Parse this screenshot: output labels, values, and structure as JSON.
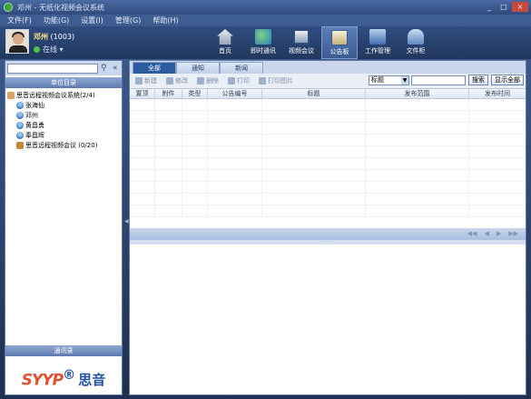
{
  "window": {
    "title": "邓州 - 无纸化视频会议系统",
    "controls": [
      "_",
      "□",
      "×"
    ]
  },
  "menu": [
    "文件(F)",
    "功能(G)",
    "设置(I)",
    "管理(G)",
    "帮助(H)"
  ],
  "user": {
    "name": "邓州",
    "id": "(1003)",
    "status": "在线"
  },
  "nav": [
    {
      "label": "首页",
      "icon": "home-icon"
    },
    {
      "label": "即时通讯",
      "icon": "chat-icon"
    },
    {
      "label": "视频会议",
      "icon": "video-icon"
    },
    {
      "label": "公告板",
      "icon": "board-icon",
      "active": true
    },
    {
      "label": "工作管理",
      "icon": "work-icon"
    },
    {
      "label": "文件柜",
      "icon": "file-icon"
    }
  ],
  "left": {
    "search_placeholder": "",
    "directory_title": "单位目录",
    "tree": [
      {
        "label": "思音远程视频会议系统(2/4)",
        "type": "group",
        "level": 0
      },
      {
        "label": "张海仙",
        "type": "person",
        "level": 1
      },
      {
        "label": "邓州",
        "type": "person",
        "level": 1
      },
      {
        "label": "黄昌勇",
        "type": "person",
        "level": 1
      },
      {
        "label": "奉昌辉",
        "type": "person",
        "level": 1
      },
      {
        "label": "思音远程视频会议 (0/20)",
        "type": "meet",
        "level": 1
      }
    ],
    "contacts_title": "通讯录",
    "logo": {
      "mark": "SYYP",
      "reg": "®",
      "name": "思音"
    }
  },
  "tabs": [
    "全部",
    "通知",
    "新闻"
  ],
  "actions": [
    "新建",
    "修改",
    "删除",
    "打印",
    "打印图片"
  ],
  "filter": {
    "field": "标题",
    "search_label": "搜索",
    "show_all_label": "显示全部"
  },
  "table": {
    "columns": [
      "置顶",
      "附件",
      "类型",
      "公告编号",
      "标题",
      "发布范围",
      "发布时间"
    ],
    "rows": []
  },
  "pager": [
    "◀◀",
    "◀",
    "▶",
    "▶▶"
  ],
  "detail_grip": "········"
}
